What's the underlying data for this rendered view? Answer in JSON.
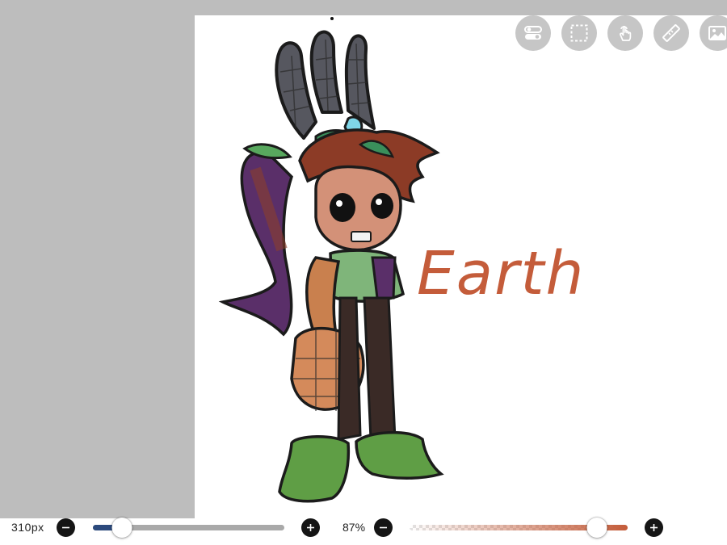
{
  "canvas": {
    "text_art": "Earth"
  },
  "toolbar": {
    "buttons": [
      {
        "name": "toggle-icon"
      },
      {
        "name": "selection-icon"
      },
      {
        "name": "touch-gesture-icon"
      },
      {
        "name": "ruler-icon"
      },
      {
        "name": "image-icon"
      }
    ]
  },
  "bottom_bar": {
    "brush_size": {
      "label": "310px",
      "level": 0.15
    },
    "opacity": {
      "label": "87%",
      "level": 0.86
    }
  },
  "colors": {
    "workspace_bg": "#bdbdbd",
    "size_slider_fill": "#2c4a7d",
    "brush_color": "#c45c3a",
    "button_dark": "#151515"
  }
}
